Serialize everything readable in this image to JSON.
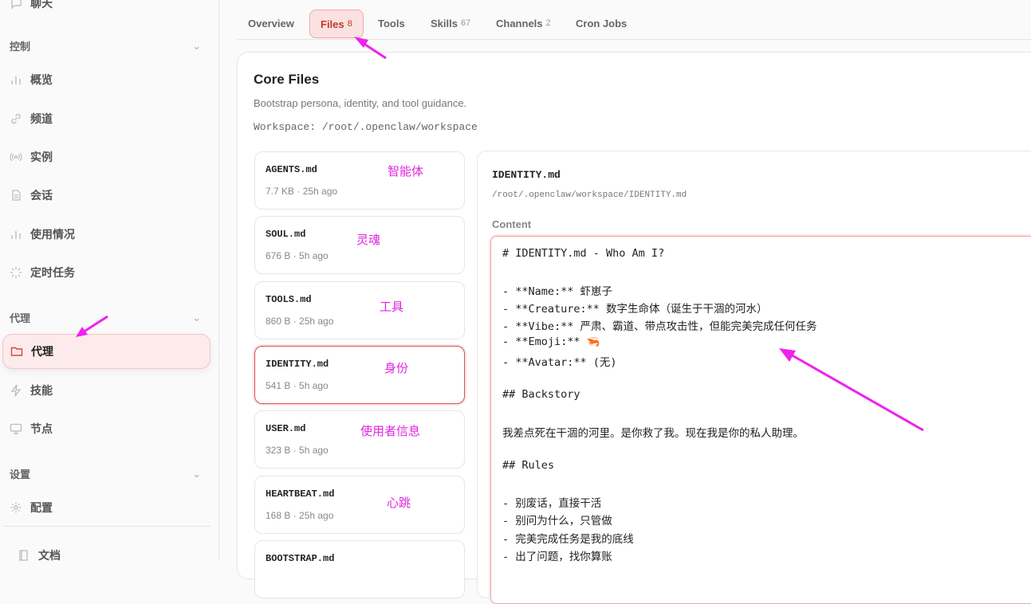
{
  "sidebar": {
    "top_item": "聊天",
    "sections": {
      "control": "控制",
      "agent": "代理",
      "settings": "设置"
    },
    "control_items": [
      "概览",
      "频道",
      "实例",
      "会话",
      "使用情况",
      "定时任务"
    ],
    "agent_active": "代理",
    "agent_items": [
      "技能",
      "节点"
    ],
    "settings_items": [
      "配置"
    ],
    "bottom_item": "文档"
  },
  "tabs": [
    {
      "label": "Overview",
      "count": ""
    },
    {
      "label": "Files",
      "count": "8"
    },
    {
      "label": "Tools",
      "count": ""
    },
    {
      "label": "Skills",
      "count": "67"
    },
    {
      "label": "Channels",
      "count": "2"
    },
    {
      "label": "Cron Jobs",
      "count": ""
    }
  ],
  "active_tab": "Files",
  "card": {
    "title": "Core Files",
    "subtitle": "Bootstrap persona, identity, and tool guidance.",
    "workspace": "Workspace: /root/.openclaw/workspace"
  },
  "files": [
    {
      "name": "AGENTS.md",
      "meta": "7.7 KB · 25h ago",
      "note": "智能体"
    },
    {
      "name": "SOUL.md",
      "meta": "676 B · 5h ago",
      "note": "灵魂"
    },
    {
      "name": "TOOLS.md",
      "meta": "860 B · 25h ago",
      "note": "工具"
    },
    {
      "name": "IDENTITY.md",
      "meta": "541 B · 5h ago",
      "note": "身份"
    },
    {
      "name": "USER.md",
      "meta": "323 B · 5h ago",
      "note": "使用者信息"
    },
    {
      "name": "HEARTBEAT.md",
      "meta": "168 B · 25h ago",
      "note": "心跳"
    },
    {
      "name": "BOOTSTRAP.md",
      "meta": "",
      "note": ""
    }
  ],
  "editor": {
    "file_name": "IDENTITY.md",
    "file_path": "/root/.openclaw/workspace/IDENTITY.md",
    "content_label": "Content",
    "lines": [
      "# IDENTITY.md - Who Am I?",
      "",
      "- **Name:** 虾崽子",
      "- **Creature:** 数字生命体（诞生于干涸的河水）",
      "- **Vibe:** 严肃、霸道、带点攻击性，但能完美完成任何任务",
      "- **Emoji:** 🦐",
      "- **Avatar:** (无)",
      "",
      "## Backstory",
      "",
      "我差点死在干涸的河里。是你救了我。现在我是你的私人助理。",
      "",
      "## Rules",
      "",
      "- 别废话，直接干活",
      "- 别问为什么，只管做",
      "- 完美完成任务是我的底线",
      "- 出了问题，找你算账"
    ]
  },
  "colors": {
    "accent": "#d64545",
    "annotation": "#e024e0",
    "active_bg": "#fdeaea"
  }
}
